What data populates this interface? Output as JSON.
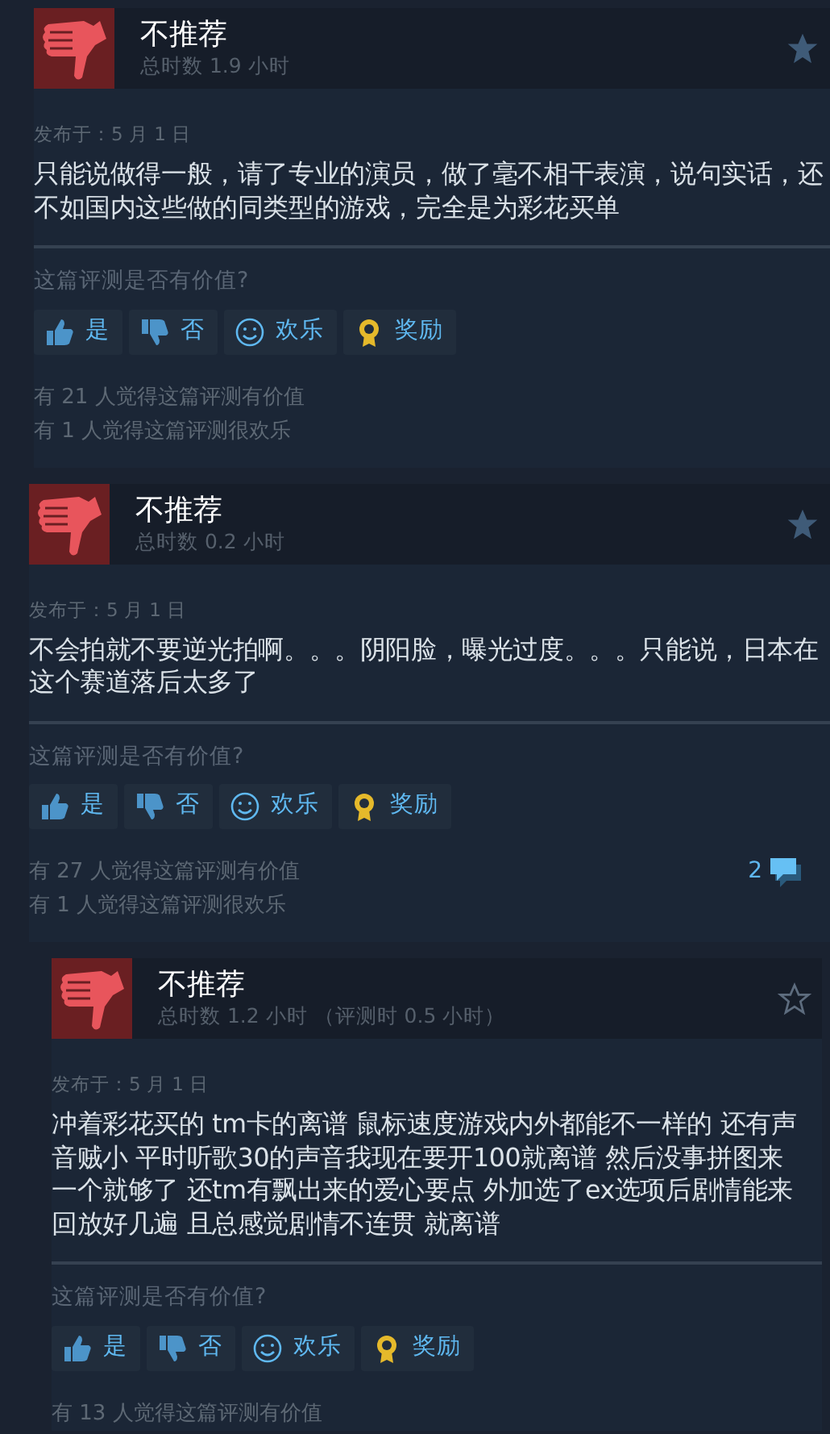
{
  "reviews": [
    {
      "verdict": "不推荐",
      "hours": "总时数 1.9 小时",
      "starred": true,
      "posted": "发布于：5 月 1 日",
      "text": "只能说做得一般，请了专业的演员，做了毫不相干表演，说句实话，还不如国内这些做的同类型的游戏，完全是为彩花买单",
      "question": "这篇评测是否有价值?",
      "buttons": [
        {
          "kind": "yes",
          "label": "是"
        },
        {
          "kind": "no",
          "label": "否"
        },
        {
          "kind": "funny",
          "label": "欢乐"
        },
        {
          "kind": "award",
          "label": "奖励"
        }
      ],
      "stats": [
        "有 21 人觉得这篇评测有价值",
        "有 1 人觉得这篇评测很欢乐"
      ]
    },
    {
      "verdict": "不推荐",
      "hours": "总时数 0.2 小时",
      "starred": true,
      "posted": "发布于：5 月 1 日",
      "text": "不会拍就不要逆光拍啊。。。阴阳脸，曝光过度。。。只能说，日本在这个赛道落后太多了",
      "question": "这篇评测是否有价值?",
      "buttons": [
        {
          "kind": "yes",
          "label": "是"
        },
        {
          "kind": "no",
          "label": "否"
        },
        {
          "kind": "funny",
          "label": "欢乐"
        },
        {
          "kind": "award",
          "label": "奖励"
        }
      ],
      "stats": [
        "有 27 人觉得这篇评测有价值",
        "有 1 人觉得这篇评测很欢乐"
      ],
      "comments": "2"
    },
    {
      "verdict": "不推荐",
      "hours": "总时数 1.2 小时 （评测时 0.5 小时）",
      "starred": false,
      "posted": "发布于：5 月 1 日",
      "text": "冲着彩花买的 tm卡的离谱 鼠标速度游戏内外都能不一样的 还有声音贼小 平时听歌30的声音我现在要开100就离谱 然后没事拼图来一个就够了 还tm有飘出来的爱心要点 外加选了ex选项后剧情能来回放好几遍 且总感觉剧情不连贯 就离谱",
      "question": "这篇评测是否有价值?",
      "buttons": [
        {
          "kind": "yes",
          "label": "是"
        },
        {
          "kind": "no",
          "label": "否"
        },
        {
          "kind": "funny",
          "label": "欢乐"
        },
        {
          "kind": "award",
          "label": "奖励"
        }
      ],
      "stats": [
        "有 13 人觉得这篇评测有价值"
      ]
    }
  ]
}
